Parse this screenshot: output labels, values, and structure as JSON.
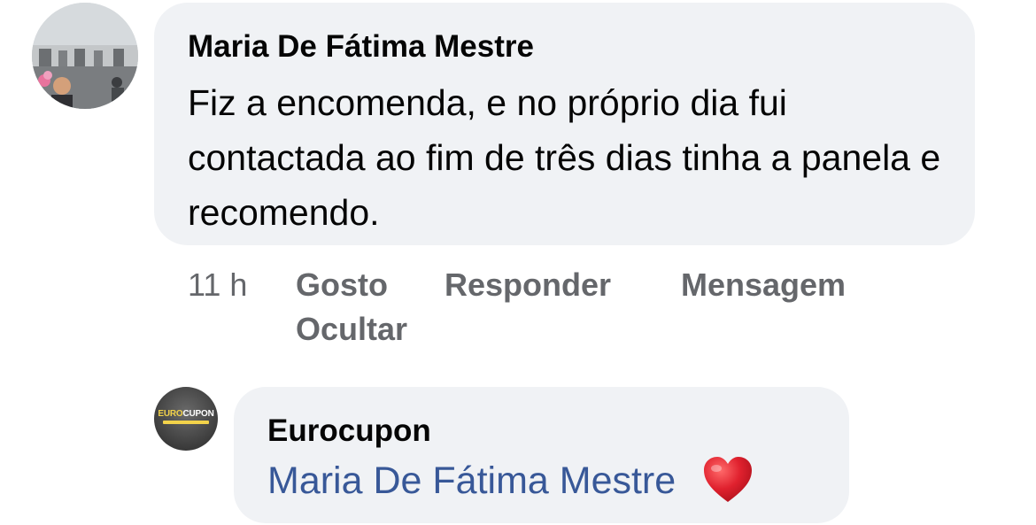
{
  "comment": {
    "author": "Maria De Fátima Mestre",
    "avatar_icon": "profile-photo",
    "text": "Fiz a encomenda, e no próprio dia fui contactada ao fim de três dias tinha a panela e recomendo.",
    "timestamp": "11 h",
    "actions": {
      "like": "Gosto",
      "reply": "Responder",
      "message": "Mensagem",
      "hide": "Ocultar"
    }
  },
  "reply": {
    "author": "Eurocupon",
    "avatar_icon": "eurocupon-logo",
    "logo_text_primary": "EURO",
    "logo_text_secondary": "CUPON",
    "mention": "Maria De Fátima Mestre",
    "emoji_icon": "heart-icon"
  },
  "colors": {
    "bubble": "#f0f2f5",
    "mention": "#385898",
    "secondary_text": "#65676b",
    "heart": "#e0212e"
  }
}
